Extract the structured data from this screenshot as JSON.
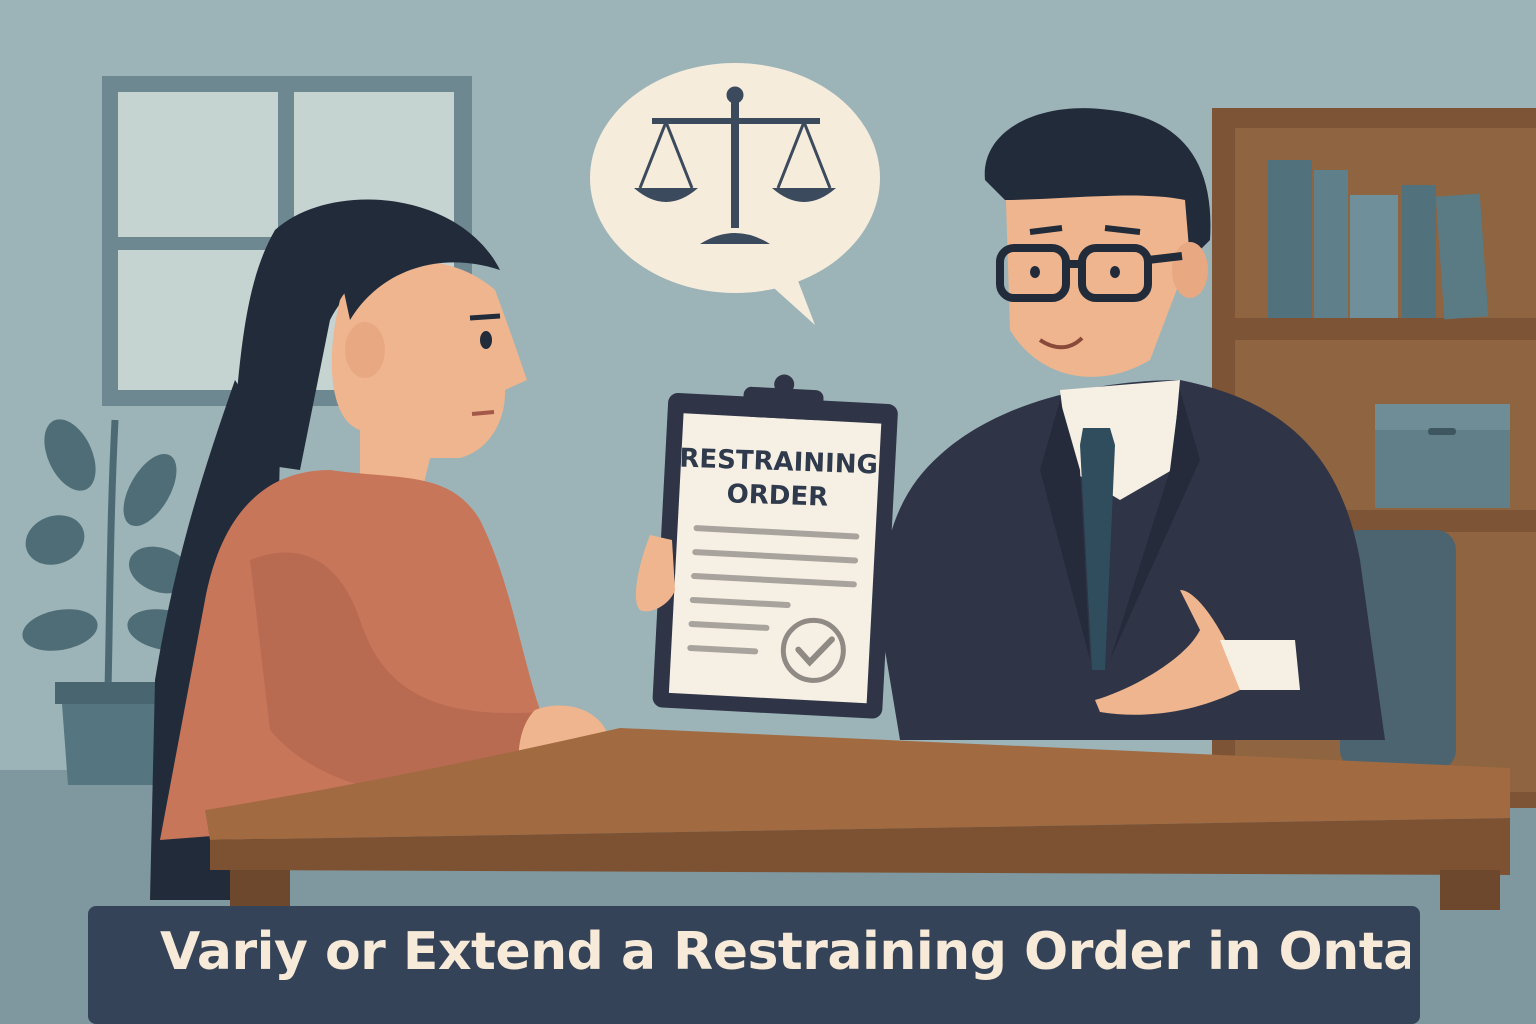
{
  "banner": {
    "title": "Variy or Extend a Restraining Order in Ontai"
  },
  "clipboard": {
    "document_title_line1": "RESTRAINING",
    "document_title_line2": "ORDER"
  },
  "speech_bubble": {
    "icon": "scales-of-justice-icon"
  },
  "document": {
    "stamp_icon": "checkmark-icon"
  },
  "colors": {
    "wall": "#9cb4b8",
    "desk": "#8a5a36",
    "banner": "#354358",
    "suit": "#2f3447",
    "sweater": "#c8765a",
    "paper": "#f6efe4"
  }
}
